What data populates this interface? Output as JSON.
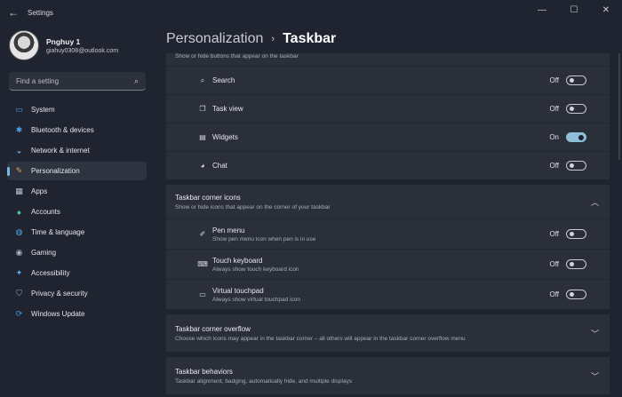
{
  "window": {
    "title": "Settings",
    "back": "←",
    "minimize": "—",
    "maximize": "☐",
    "close": "✕"
  },
  "profile": {
    "name": "Pnghuy 1",
    "email": "giahuy0308@outlook.com"
  },
  "search": {
    "placeholder": "Find a setting",
    "icon": "⌕"
  },
  "nav": [
    {
      "label": "System",
      "icon": "system-icon",
      "glyph": "▭",
      "color": "#4a9fe0"
    },
    {
      "label": "Bluetooth & devices",
      "icon": "bluetooth-icon",
      "glyph": "✱",
      "color": "#4a9fe0"
    },
    {
      "label": "Network & internet",
      "icon": "wifi-icon",
      "glyph": "◒",
      "color": "#5aa7e6"
    },
    {
      "label": "Personalization",
      "icon": "brush-icon",
      "glyph": "✎",
      "color": "#e3a34f",
      "active": true
    },
    {
      "label": "Apps",
      "icon": "apps-icon",
      "glyph": "▦",
      "color": "#b8c4d6"
    },
    {
      "label": "Accounts",
      "icon": "person-icon",
      "glyph": "●",
      "color": "#4fc29a"
    },
    {
      "label": "Time & language",
      "icon": "globe-icon",
      "glyph": "◍",
      "color": "#4aa6e6"
    },
    {
      "label": "Gaming",
      "icon": "gamepad-icon",
      "glyph": "◉",
      "color": "#a9b3c2"
    },
    {
      "label": "Accessibility",
      "icon": "accessibility-icon",
      "glyph": "✦",
      "color": "#5ab1ea"
    },
    {
      "label": "Privacy & security",
      "icon": "shield-icon",
      "glyph": "⛉",
      "color": "#9aa3b1"
    },
    {
      "label": "Windows Update",
      "icon": "update-icon",
      "glyph": "⟳",
      "color": "#3f9de3"
    }
  ],
  "header": {
    "crumb": "Personalization",
    "separator": "›",
    "current": "Taskbar"
  },
  "taskbar_items": {
    "desc": "Show or hide buttons that appear on the taskbar",
    "items": [
      {
        "label": "Search",
        "icon": "search-icon",
        "glyph": "⌕",
        "state": "Off",
        "on": false
      },
      {
        "label": "Task view",
        "icon": "taskview-icon",
        "glyph": "❐",
        "state": "Off",
        "on": false
      },
      {
        "label": "Widgets",
        "icon": "widgets-icon",
        "glyph": "▤",
        "state": "On",
        "on": true
      },
      {
        "label": "Chat",
        "icon": "chat-icon",
        "glyph": "◕",
        "state": "Off",
        "on": false
      }
    ]
  },
  "corner_icons": {
    "title": "Taskbar corner icons",
    "desc": "Show or hide icons that appear on the corner of your taskbar",
    "chevron": "︿",
    "items": [
      {
        "label": "Pen menu",
        "sub": "Show pen menu icon when pen is in use",
        "icon": "pen-icon",
        "glyph": "✐",
        "state": "Off",
        "on": false
      },
      {
        "label": "Touch keyboard",
        "sub": "Always show touch keyboard icon",
        "icon": "keyboard-icon",
        "glyph": "⌨",
        "state": "Off",
        "on": false
      },
      {
        "label": "Virtual touchpad",
        "sub": "Always show virtual touchpad icon",
        "icon": "touchpad-icon",
        "glyph": "▭",
        "state": "Off",
        "on": false
      }
    ]
  },
  "corner_overflow": {
    "title": "Taskbar corner overflow",
    "desc": "Choose which icons may appear in the taskbar corner – all others will appear in the taskbar corner overflow menu",
    "chevron": "﹀"
  },
  "behaviors": {
    "title": "Taskbar behaviors",
    "desc": "Taskbar alignment, badging, automatically hide, and multiple displays",
    "chevron": "﹀"
  }
}
